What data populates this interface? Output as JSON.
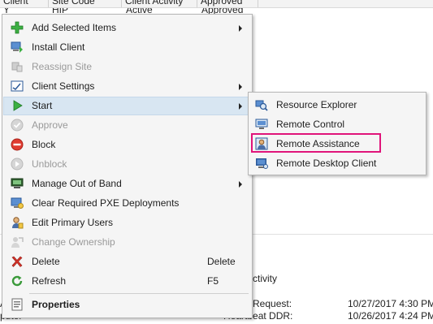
{
  "background": {
    "columns": [
      "Client",
      "Site Code",
      "Client Activity",
      "Approved"
    ],
    "row_fragments": [
      "Y",
      "HIP",
      "Active",
      "Approved"
    ],
    "activity_label": "ctivity",
    "req_label": "Request:",
    "req_value": "10/27/2017 4:30 PM",
    "hb_label": "Heartbeat DDR:",
    "hb_value": "10/26/2017 4:24 PM",
    "left_a": "A",
    "left_puter": "puter"
  },
  "menu": {
    "items": [
      {
        "label": "Add Selected Items",
        "icon": "add-icon"
      },
      {
        "label": "Install Client",
        "icon": "install-client-icon"
      },
      {
        "label": "Reassign Site",
        "icon": "reassign-site-icon"
      },
      {
        "label": "Client Settings",
        "icon": "client-settings-icon"
      },
      {
        "label": "Start",
        "icon": "start-play-icon"
      },
      {
        "label": "Approve",
        "icon": "approve-check-icon"
      },
      {
        "label": "Block",
        "icon": "block-icon"
      },
      {
        "label": "Unblock",
        "icon": "unblock-icon"
      },
      {
        "label": "Manage Out of Band",
        "icon": "out-of-band-icon"
      },
      {
        "label": "Clear Required PXE Deployments",
        "icon": "pxe-icon"
      },
      {
        "label": "Edit Primary Users",
        "icon": "primary-users-icon"
      },
      {
        "label": "Change Ownership",
        "icon": "change-ownership-icon"
      },
      {
        "label": "Delete",
        "icon": "delete-x-icon",
        "shortcut": "Delete"
      },
      {
        "label": "Refresh",
        "icon": "refresh-icon",
        "shortcut": "F5"
      },
      {
        "label": "Properties",
        "icon": "properties-icon"
      }
    ]
  },
  "submenu": {
    "items": [
      {
        "label": "Resource Explorer",
        "icon": "resource-explorer-icon"
      },
      {
        "label": "Remote Control",
        "icon": "remote-control-icon"
      },
      {
        "label": "Remote Assistance",
        "icon": "remote-assistance-icon"
      },
      {
        "label": "Remote Desktop Client",
        "icon": "remote-desktop-icon"
      }
    ]
  },
  "colors": {
    "highlight": "#e0147a",
    "active_item": "#d8e6f2"
  }
}
